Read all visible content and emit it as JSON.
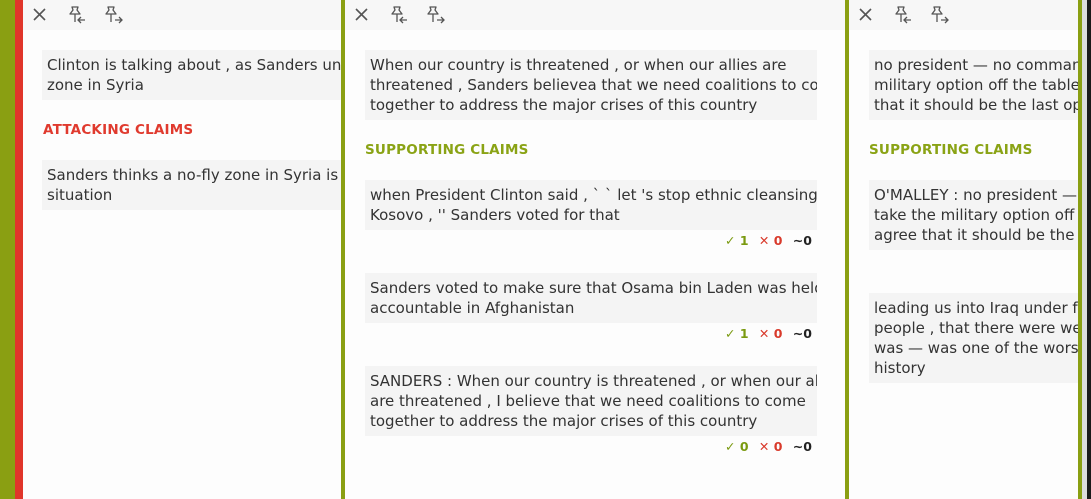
{
  "colors": {
    "green": "#8a9f12",
    "red": "#e0352a",
    "attack": "#e03a2e",
    "support": "#8aa315",
    "card_bg": "#f4f4f4",
    "toolbar_bg": "#f7f7f7"
  },
  "toolbar_icons": [
    "close-icon",
    "pin-in-icon",
    "pin-out-icon"
  ],
  "panel_left": {
    "card1": [
      "Clinton is talking about , as Sanders under",
      "zone in Syria"
    ],
    "heading": "ATTACKING CLAIMS",
    "card2": [
      "Sanders thinks a no-fly zone in Syria is a v",
      "situation"
    ]
  },
  "panel_middle": {
    "main_card": [
      "When our country is threatened , or when our allies are",
      "threatened , Sanders believea that we need coalitions to come",
      "together to address the major crises of this country"
    ],
    "heading": "SUPPORTING CLAIMS",
    "claims": [
      {
        "lines": [
          "when President Clinton said , ` ` let 's stop ethnic cleansing in",
          "Kosovo , '' Sanders voted for that"
        ],
        "up": "1",
        "down": "0",
        "neutral": "0"
      },
      {
        "lines": [
          "Sanders voted to make sure that Osama bin Laden was held",
          "accountable in Afghanistan"
        ],
        "up": "1",
        "down": "0",
        "neutral": "0"
      },
      {
        "lines": [
          "SANDERS : When our country is threatened , or when our allies",
          "are threatened , I believe that we need coalitions to come",
          "together to address the major crises of this country"
        ],
        "up": "0",
        "down": "0",
        "neutral": "0"
      }
    ]
  },
  "panel_right": {
    "main_card": [
      "no president — no commande",
      "military option off the table , o",
      "that it should be the last optio"
    ],
    "heading": "SUPPORTING CLAIMS",
    "claims": [
      [
        "O'MALLEY : no president — no",
        "take the military option off the",
        "agree that it should be the las"
      ],
      [
        "leading us into Iraq under fals",
        "people , that there were weap",
        "was — was one of the worst b",
        "history"
      ]
    ]
  }
}
